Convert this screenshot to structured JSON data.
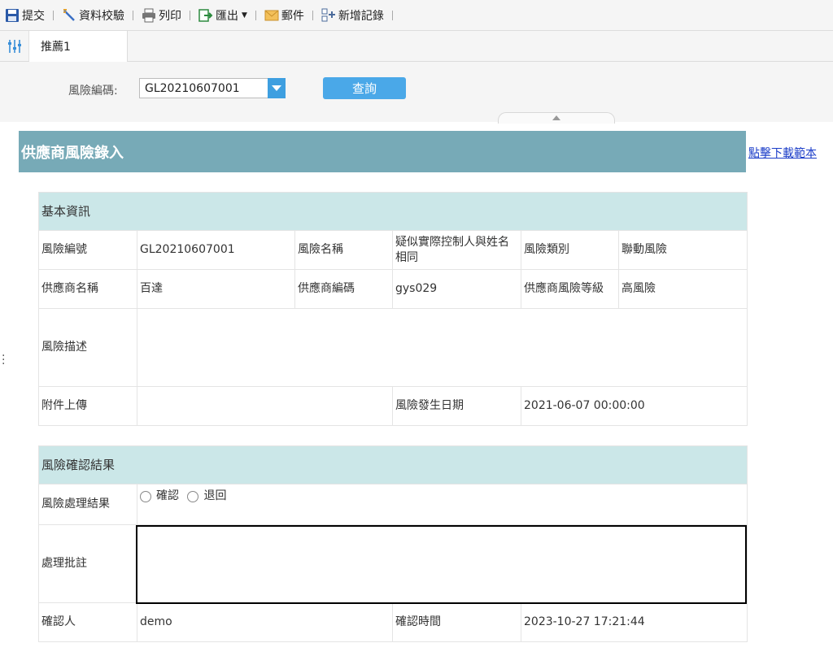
{
  "toolbar": {
    "items": [
      {
        "label": "提交",
        "icon": "save-icon"
      },
      {
        "label": "資料校驗",
        "icon": "validate-icon"
      },
      {
        "label": "列印",
        "icon": "print-icon"
      },
      {
        "label": "匯出",
        "icon": "export-icon"
      },
      {
        "label": "郵件",
        "icon": "mail-icon"
      },
      {
        "label": "新增記錄",
        "icon": "add-record-icon"
      }
    ]
  },
  "tabs": {
    "active": "推薦1"
  },
  "query": {
    "label": "風險編碼:",
    "select_value": "GL20210607001",
    "button": "查詢"
  },
  "form": {
    "title": "供應商風險錄入",
    "download_link": "點擊下載範本",
    "basic": {
      "section": "基本資訊",
      "risk_no_label": "風險編號",
      "risk_no": "GL20210607001",
      "risk_name_label": "風險名稱",
      "risk_name": "疑似實際控制人與姓名相同",
      "risk_type_label": "風險類別",
      "risk_type": "聯動風險",
      "supplier_name_label": "供應商名稱",
      "supplier_name": "百達",
      "supplier_code_label": "供應商編碼",
      "supplier_code": "gys029",
      "supplier_level_label": "供應商風險等級",
      "supplier_level": "高風險",
      "desc_label": "風險描述",
      "attach_label": "附件上傳",
      "date_label": "風險發生日期",
      "date": "2021-06-07 00:00:00"
    },
    "confirm": {
      "section": "風險確認結果",
      "result_label": "風險處理結果",
      "option_confirm": "確認",
      "option_return": "退回",
      "note_label": "處理批註",
      "confirmer_label": "確認人",
      "confirmer": "demo",
      "time_label": "確認時間",
      "time": "2023-10-27 17:21:44"
    }
  }
}
